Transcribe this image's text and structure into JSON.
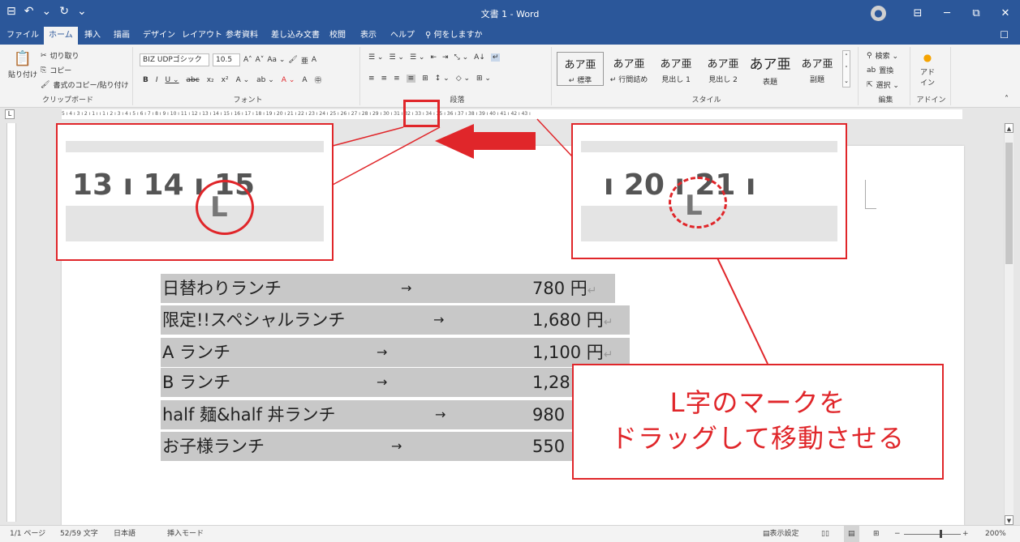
{
  "window": {
    "title": "文書 1  -  Word",
    "qat": [
      "⊟",
      "↶",
      "⌄",
      "↻",
      "⌄"
    ],
    "controls": [
      "⊟",
      "─",
      "⧉",
      "✕"
    ]
  },
  "tabs": [
    "ファイル",
    "ホーム",
    "挿入",
    "描画",
    "デザイン",
    "レイアウト",
    "参考資料",
    "差し込み文書",
    "校閲",
    "表示",
    "ヘルプ",
    "何をしますか"
  ],
  "ribbon": {
    "clipboard": {
      "paste": "貼り付け",
      "cut": "切り取り",
      "copy": "コピー",
      "format_painter": "書式のコピー/貼り付け",
      "label": "クリップボード"
    },
    "font": {
      "name": "BIZ UDPゴシック",
      "size": "10.5",
      "label": "フォント",
      "buttons_row1": [
        "A˄",
        "A˅",
        "Aa ⌄",
        "🖌",
        "亜",
        "A"
      ],
      "buttons_row2": [
        "B",
        "I",
        "U ⌄",
        "abc",
        "x₂",
        "x²",
        "A ⌄",
        "ab ⌄",
        "A ⌄",
        "A",
        "㊥"
      ]
    },
    "paragraph": {
      "label": "段落",
      "buttons_row1": [
        "☰ ⌄",
        "☰ ⌄",
        "☰ ⌄",
        "⇤",
        "⇥",
        "⤡ ⌄",
        "A↓",
        "↵"
      ],
      "buttons_row2": [
        "≡",
        "≡",
        "≡",
        "≡",
        "⊞",
        "↕ ⌄",
        "◇ ⌄",
        "⊞ ⌄"
      ]
    },
    "styles": {
      "label": "スタイル",
      "items": [
        {
          "preview": "あア亜",
          "name": "↵ 標準"
        },
        {
          "preview": "あア亜",
          "name": "↵ 行間詰め"
        },
        {
          "preview": "あア亜",
          "name": "見出し 1"
        },
        {
          "preview": "あア亜",
          "name": "見出し 2"
        },
        {
          "preview": "あア亜",
          "name": "表題"
        },
        {
          "preview": "あア亜",
          "name": "副題"
        }
      ]
    },
    "editing": {
      "label": "編集",
      "find": "検索 ⌄",
      "replace": "置換",
      "select": "選択 ⌄"
    },
    "addin": {
      "label": "アドイン",
      "name": "アド\nイン"
    }
  },
  "ruler": {
    "text": "5 ı 4 ı 3 ı 2 ı 1 ı    ı 1 ı 2 ı 3 ı 4 ı 5 ı 6 ı 7 ı 8 ı 9 ı 10 ı 11 ı 12 ı 13 ı 14 ı 15 ı 16 ı 17 ı 18 ı 19 ı 20 ı 21 ı 22 ı 23 ı 24 ı 25 ı 26 ı 27 ı 28 ı 29 ı 30 ı 31 ı 32 ı 33 ı 34 ı 35 ı 36 ı 37 ı 38 ı 39 ı 40 ı 41 ı 42 ı 43 ı",
    "tab_selector": "L"
  },
  "menu": [
    {
      "name": "日替わりランチ",
      "arrow": "→",
      "price": "780 円",
      "ret": "↵"
    },
    {
      "name": "限定!!スペシャルランチ",
      "arrow": "→",
      "price": "1,680 円",
      "ret": "↵"
    },
    {
      "name": "A ランチ",
      "arrow": "→",
      "price": "1,100 円",
      "ret": "↵"
    },
    {
      "name": "B ランチ",
      "arrow": "→",
      "price": "1,28",
      "ret": ""
    },
    {
      "name": "half 麺&half 丼ランチ",
      "arrow": "→",
      "price": "980",
      "ret": ""
    },
    {
      "name": "お子様ランチ",
      "arrow": "→",
      "price": "550",
      "ret": ""
    }
  ],
  "zoom_left": {
    "text": "13  ı  14  ı  15",
    "mark": "L"
  },
  "zoom_right": {
    "text": "ı  20  ı  21  ı",
    "mark": "L"
  },
  "callout": {
    "line1": "L字のマークを",
    "line2": "ドラッグして移動させる"
  },
  "status": {
    "page": "1/1 ページ",
    "words": "52/59 文字",
    "language": "日本語",
    "mode": "挿入モード",
    "display_settings": "表示設定",
    "zoom": "200%"
  },
  "colors": {
    "accent": "#2b579a",
    "annotation_red": "#e0262a",
    "selection": "#c8c8c8"
  }
}
